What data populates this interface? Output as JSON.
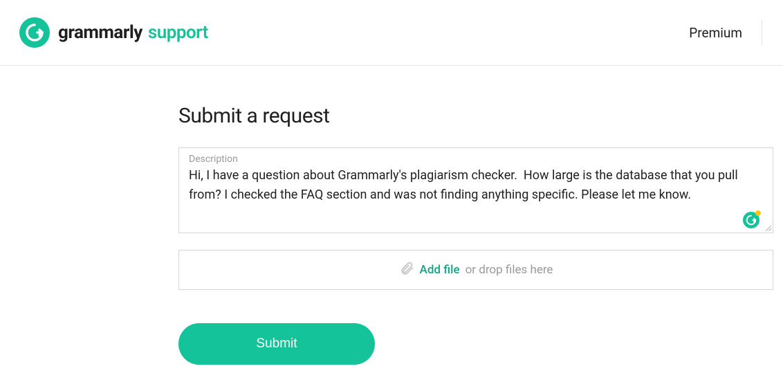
{
  "header": {
    "brand_name": "grammarly",
    "brand_sub": "support",
    "nav_premium": "Premium"
  },
  "form": {
    "title": "Submit a request",
    "description_label": "Description",
    "description_value": "Hi, I have a question about Grammarly's plagiarism checker.  How large is the database that you pull from? I checked the FAQ section and was not finding anything specific. Please let me know.",
    "add_file_label": "Add file",
    "drop_hint": "or drop files here",
    "submit_label": "Submit"
  },
  "colors": {
    "accent": "#15c39a",
    "accent_dark": "#11a683"
  }
}
